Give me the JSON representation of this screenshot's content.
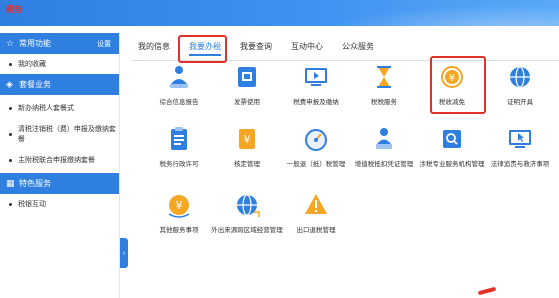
{
  "header": {
    "logo_text": "税务"
  },
  "sidebar": {
    "sections": [
      {
        "title": "常用功能",
        "extra": "设置",
        "icon": "star-icon",
        "items": [
          "我的收藏"
        ]
      },
      {
        "title": "套餐业务",
        "icon": "layers-icon",
        "items": [
          "新办纳税人套餐式",
          "清税注销税（费）申报及缴纳套餐",
          "主附税联合申报缴纳套餐"
        ]
      },
      {
        "title": "特色服务",
        "icon": "grid-icon",
        "items": [
          "税银互动"
        ]
      }
    ],
    "collapse_glyph": "‹"
  },
  "tabs": [
    "我的信息",
    "我要办税",
    "我要查询",
    "互动中心",
    "公众服务"
  ],
  "active_tab": "我要办税",
  "grid": [
    {
      "label": "综合信息报告",
      "icon": "person-report-icon",
      "color": "#2f7fe0"
    },
    {
      "label": "发票使用",
      "icon": "invoice-icon",
      "color": "#2f7fe0"
    },
    {
      "label": "税费申报及缴纳",
      "icon": "monitor-declare-icon",
      "color": "#2f7fe0"
    },
    {
      "label": "税税服务",
      "icon": "hourglass-icon",
      "color": "#f5a623"
    },
    {
      "label": "税收减免",
      "icon": "yuan-cycle-icon",
      "color": "#f5a623"
    },
    {
      "label": "证明开具",
      "icon": "globe-icon",
      "color": "#2f7fe0"
    },
    {
      "label": "税务行政许可",
      "icon": "clipboard-icon",
      "color": "#2f7fe0"
    },
    {
      "label": "核定管理",
      "icon": "yuan-document-icon",
      "color": "#f5a623"
    },
    {
      "label": "一般退（抵）税管理",
      "icon": "gauge-icon",
      "color": "#2f7fe0"
    },
    {
      "label": "增值税抵扣凭证管理",
      "icon": "person-stamp-icon",
      "color": "#2f7fe0"
    },
    {
      "label": "涉税专业服务机构管理",
      "icon": "search-doc-icon",
      "color": "#2f7fe0"
    },
    {
      "label": "法律追责与救济事项",
      "icon": "monitor-pointer-icon",
      "color": "#2f7fe0"
    },
    {
      "label": "其他服务事项",
      "icon": "yuan-coin-icon",
      "color": "#f5a623"
    },
    {
      "label": "外出来源跨区域经营管理",
      "icon": "globe-arrow-icon",
      "color": "#2f7fe0"
    },
    {
      "label": "出口退税管理",
      "icon": "warning-icon",
      "color": "#f5a623"
    }
  ]
}
